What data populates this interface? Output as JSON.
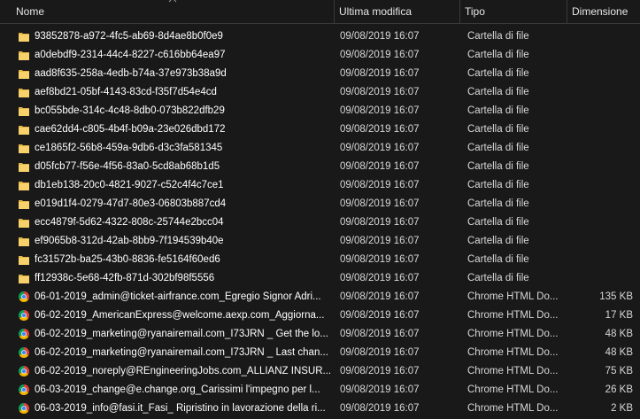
{
  "columns": {
    "name": "Nome",
    "date": "Ultima modifica",
    "type": "Tipo",
    "size": "Dimensione"
  },
  "files": [
    {
      "icon": "folder-icon",
      "name": "93852878-a972-4fc5-ab69-8d4ae8b0f0e9",
      "date": "09/08/2019 16:07",
      "type": "Cartella di file",
      "size": ""
    },
    {
      "icon": "folder-icon",
      "name": "a0debdf9-2314-44c4-8227-c616bb64ea97",
      "date": "09/08/2019 16:07",
      "type": "Cartella di file",
      "size": ""
    },
    {
      "icon": "folder-icon",
      "name": "aad8f635-258a-4edb-b74a-37e973b38a9d",
      "date": "09/08/2019 16:07",
      "type": "Cartella di file",
      "size": ""
    },
    {
      "icon": "folder-icon",
      "name": "aef8bd21-05bf-4143-83cd-f35f7d54e4cd",
      "date": "09/08/2019 16:07",
      "type": "Cartella di file",
      "size": ""
    },
    {
      "icon": "folder-icon",
      "name": "bc055bde-314c-4c48-8db0-073b822dfb29",
      "date": "09/08/2019 16:07",
      "type": "Cartella di file",
      "size": ""
    },
    {
      "icon": "folder-icon",
      "name": "cae62dd4-c805-4b4f-b09a-23e026dbd172",
      "date": "09/08/2019 16:07",
      "type": "Cartella di file",
      "size": ""
    },
    {
      "icon": "folder-icon",
      "name": "ce1865f2-56b8-459a-9db6-d3c3fa581345",
      "date": "09/08/2019 16:07",
      "type": "Cartella di file",
      "size": ""
    },
    {
      "icon": "folder-icon",
      "name": "d05fcb77-f56e-4f56-83a0-5cd8ab68b1d5",
      "date": "09/08/2019 16:07",
      "type": "Cartella di file",
      "size": ""
    },
    {
      "icon": "folder-icon",
      "name": "db1eb138-20c0-4821-9027-c52c4f4c7ce1",
      "date": "09/08/2019 16:07",
      "type": "Cartella di file",
      "size": ""
    },
    {
      "icon": "folder-icon",
      "name": "e019d1f4-0279-47d7-80e3-06803b887cd4",
      "date": "09/08/2019 16:07",
      "type": "Cartella di file",
      "size": ""
    },
    {
      "icon": "folder-icon",
      "name": "ecc4879f-5d62-4322-808c-25744e2bcc04",
      "date": "09/08/2019 16:07",
      "type": "Cartella di file",
      "size": ""
    },
    {
      "icon": "folder-icon",
      "name": "ef9065b8-312d-42ab-8bb9-7f194539b40e",
      "date": "09/08/2019 16:07",
      "type": "Cartella di file",
      "size": ""
    },
    {
      "icon": "folder-icon",
      "name": "fc31572b-ba25-43b0-8836-fe5164f60ed6",
      "date": "09/08/2019 16:07",
      "type": "Cartella di file",
      "size": ""
    },
    {
      "icon": "folder-icon",
      "name": "ff12938c-5e68-42fb-871d-302bf98f5556",
      "date": "09/08/2019 16:07",
      "type": "Cartella di file",
      "size": ""
    },
    {
      "icon": "chrome-icon",
      "name": "06-01-2019_admin@ticket-airfrance.com_Egregio Signor Adri...",
      "date": "09/08/2019 16:07",
      "type": "Chrome HTML Do...",
      "size": "135 KB"
    },
    {
      "icon": "chrome-icon",
      "name": "06-02-2019_AmericanExpress@welcome.aexp.com_Aggiorna...",
      "date": "09/08/2019 16:07",
      "type": "Chrome HTML Do...",
      "size": "17 KB"
    },
    {
      "icon": "chrome-icon",
      "name": "06-02-2019_marketing@ryanairemail.com_I73JRN _ Get the lo...",
      "date": "09/08/2019 16:07",
      "type": "Chrome HTML Do...",
      "size": "48 KB"
    },
    {
      "icon": "chrome-icon",
      "name": "06-02-2019_marketing@ryanairemail.com_I73JRN _ Last chan...",
      "date": "09/08/2019 16:07",
      "type": "Chrome HTML Do...",
      "size": "48 KB"
    },
    {
      "icon": "chrome-icon",
      "name": "06-02-2019_noreply@REngineeringJobs.com_ALLIANZ INSUR...",
      "date": "09/08/2019 16:07",
      "type": "Chrome HTML Do...",
      "size": "75 KB"
    },
    {
      "icon": "chrome-icon",
      "name": "06-03-2019_change@e.change.org_Carissimi l'impegno per l...",
      "date": "09/08/2019 16:07",
      "type": "Chrome HTML Do...",
      "size": "26 KB"
    },
    {
      "icon": "chrome-icon",
      "name": "06-03-2019_info@fasi.it_Fasi_ Ripristino in lavorazione della ri...",
      "date": "09/08/2019 16:07",
      "type": "Chrome HTML Do...",
      "size": "2 KB"
    }
  ],
  "colors": {
    "background": "#191919",
    "folder": "#f8d16a",
    "folder_dark": "#e2b546",
    "chrome_red": "#db4437",
    "chrome_green": "#0f9d58",
    "chrome_yellow": "#f4b400",
    "chrome_blue": "#4285f4"
  }
}
